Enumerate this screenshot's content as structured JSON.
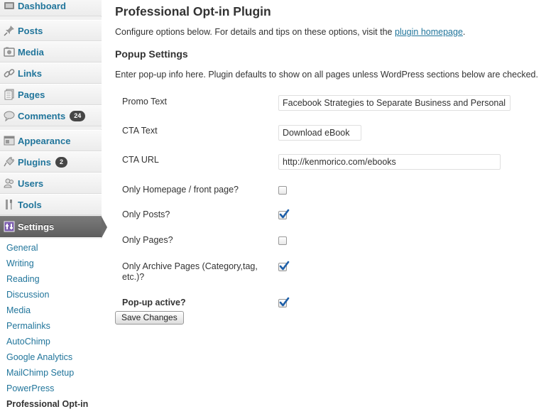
{
  "sidebar": {
    "menu": [
      {
        "label": "Dashboard",
        "icon": "dashboard-icon"
      },
      {
        "label": "Posts",
        "icon": "pin-icon"
      },
      {
        "label": "Media",
        "icon": "media-icon"
      },
      {
        "label": "Links",
        "icon": "link-icon"
      },
      {
        "label": "Pages",
        "icon": "pages-icon"
      },
      {
        "label": "Comments",
        "icon": "comment-icon",
        "badge": "24"
      },
      {
        "label": "Appearance",
        "icon": "appearance-icon"
      },
      {
        "label": "Plugins",
        "icon": "plugin-icon",
        "badge": "2"
      },
      {
        "label": "Users",
        "icon": "users-icon"
      },
      {
        "label": "Tools",
        "icon": "tools-icon"
      },
      {
        "label": "Settings",
        "icon": "settings-icon"
      }
    ],
    "submenu": [
      "General",
      "Writing",
      "Reading",
      "Discussion",
      "Media",
      "Permalinks",
      "AutoChimp",
      "Google Analytics",
      "MailChimp Setup",
      "PowerPress",
      "Professional Opt-in"
    ]
  },
  "main": {
    "title": "Professional Opt-in Plugin",
    "intro_text": "Configure options below. For details and tips on these options, visit the",
    "intro_link": "plugin homepage",
    "intro_end": ".",
    "section_title": "Popup Settings",
    "section_desc": "Enter pop-up info here. Plugin defaults to show on all pages unless WordPress sections below are checked.",
    "promo_label": "Promo Text",
    "promo_value": "Facebook Strategies to Separate Business and Personal",
    "cta_text_label": "CTA Text",
    "cta_text_value": "Download eBook",
    "cta_url_label": "CTA URL",
    "cta_url_value": "http://kenmorico.com/ebooks",
    "only_home_label": "Only Homepage / front page?",
    "only_home_checked": false,
    "only_posts_label": "Only Posts?",
    "only_posts_checked": true,
    "only_pages_label": "Only Pages?",
    "only_pages_checked": false,
    "only_archive_label_1": "Only Archive Pages (Category,tag,",
    "only_archive_label_2": "etc.)?",
    "only_archive_checked": true,
    "popup_active_label": "Pop-up active?",
    "popup_active_checked": true,
    "save_label": "Save Changes"
  },
  "colors": {
    "link": "#21759b",
    "sidebar_bg": "#f1f1f1",
    "current_menu": "#6b6b6b",
    "check": "#1e5fa8"
  }
}
